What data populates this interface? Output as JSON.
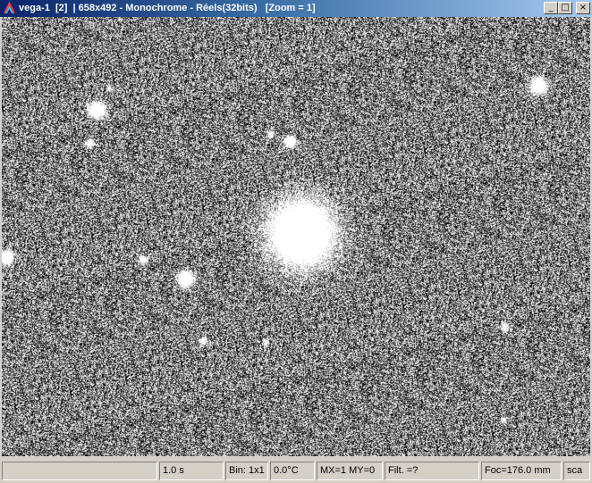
{
  "window": {
    "title": "vega-1  [2]  | 658x492 - Monochrome - Réels(32bits)   [Zoom = 1]",
    "buttons": {
      "minimize": "_",
      "maximize": "□",
      "close": "×"
    }
  },
  "status": {
    "panels": [
      "",
      "1.0 s",
      "Bin: 1x1",
      "0.0°C",
      "MX=1 MY=0",
      "Filt. =?",
      "Foc=176.0 mm",
      "sca"
    ]
  }
}
